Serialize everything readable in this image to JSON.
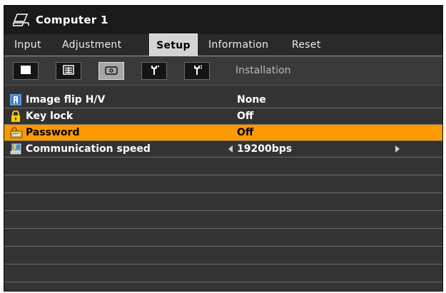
{
  "window": {
    "title": "Computer 1",
    "icon": "computer-input-icon"
  },
  "tabs": [
    {
      "label": "Input",
      "active": false
    },
    {
      "label": "Adjustment",
      "active": false
    },
    {
      "label": "Setup",
      "active": true
    },
    {
      "label": "Information",
      "active": false
    },
    {
      "label": "Reset",
      "active": false
    }
  ],
  "toolbar": {
    "buttons": [
      {
        "icon": "square-icon",
        "active": false
      },
      {
        "icon": "menu-grid-icon",
        "active": false
      },
      {
        "icon": "projector-icon",
        "active": true
      },
      {
        "icon": "wrench-icon",
        "active": false
      },
      {
        "icon": "wrench-plus-icon",
        "active": false
      }
    ],
    "section_label": "Installation"
  },
  "rows": [
    {
      "icon": "image-flip-icon",
      "label": "Image flip H/V",
      "value": "None",
      "selected": false,
      "arrows": false
    },
    {
      "icon": "lock-icon",
      "label": "Key lock",
      "value": "Off",
      "selected": false,
      "arrows": false
    },
    {
      "icon": "password-icon",
      "label": "Password",
      "value": "Off",
      "selected": true,
      "arrows": false
    },
    {
      "icon": "communication-icon",
      "label": "Communication speed",
      "value": "19200bps",
      "selected": false,
      "arrows": true
    }
  ],
  "colors": {
    "highlight": "#ff9900",
    "background": "#333333",
    "tab_active": "#d4d4d4"
  }
}
